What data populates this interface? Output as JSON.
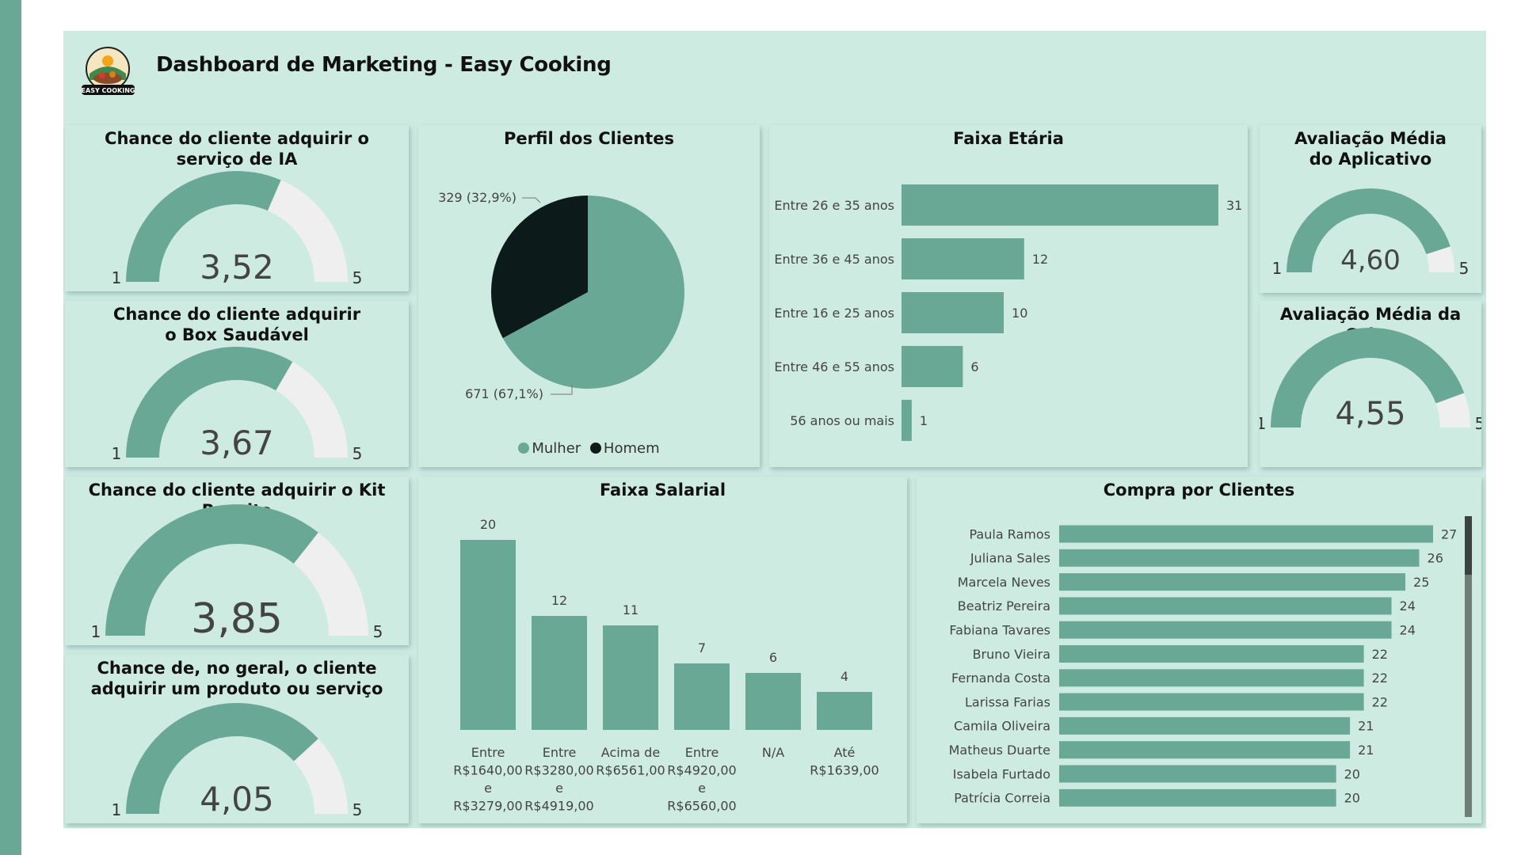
{
  "title": "Dashboard de Marketing - Easy Cooking",
  "logo_text": "EASY COOKING",
  "colors": {
    "primary": "#6aa896",
    "track": "#efefef",
    "dark": "#0d1a1a",
    "background": "#ceebe2"
  },
  "gauges": [
    {
      "title": "Chance do cliente adquirir o serviço de IA",
      "value": 3.52,
      "value_label": "3,52",
      "min_label": "1",
      "max_label": "5",
      "min": 1,
      "max": 5
    },
    {
      "title": "Chance do cliente adquirir o Box Saudável",
      "value": 3.67,
      "value_label": "3,67",
      "min_label": "1",
      "max_label": "5",
      "min": 1,
      "max": 5
    },
    {
      "title": "Chance do cliente adquirir o Kit Receita",
      "value": 3.85,
      "value_label": "3,85",
      "min_label": "1",
      "max_label": "5",
      "min": 1,
      "max": 5
    },
    {
      "title": "Chance de, no geral, o cliente adquirir um produto ou serviço",
      "value": 4.05,
      "value_label": "4,05",
      "min_label": "1",
      "max_label": "5",
      "min": 1,
      "max": 5
    },
    {
      "title": "Avaliação Média do Aplicativo",
      "value": 4.6,
      "value_label": "4,60",
      "min_label": "1",
      "max_label": "5",
      "min": 1,
      "max": 5
    },
    {
      "title": "Avaliação Média da Caixa",
      "value": 4.55,
      "value_label": "4,55",
      "min_label": "1",
      "max_label": "5",
      "min": 1,
      "max": 5
    }
  ],
  "chart_data": [
    {
      "type": "pie",
      "title": "Perfil dos Clientes",
      "categories": [
        "Mulher",
        "Homem"
      ],
      "values": [
        671,
        329
      ],
      "labels": [
        "671 (67,1%)",
        "329 (32,9%)"
      ],
      "colors": [
        "#6aa896",
        "#0d1a1a"
      ]
    },
    {
      "type": "bar",
      "orientation": "horizontal",
      "title": "Faixa Etária",
      "categories": [
        "Entre 26 e 35 anos",
        "Entre 36 e 45 anos",
        "Entre 16 e 25 anos",
        "Entre 46 e 55 anos",
        "56 anos ou mais"
      ],
      "values": [
        31,
        12,
        10,
        6,
        1
      ]
    },
    {
      "type": "bar",
      "title": "Faixa Salarial",
      "categories": [
        [
          "Entre",
          "R$1640,00",
          "e",
          "R$3279,00"
        ],
        [
          "Entre",
          "R$3280,00",
          "e",
          "R$4919,00"
        ],
        [
          "Acima de",
          "R$6561,00"
        ],
        [
          "Entre",
          "R$4920,00",
          "e",
          "R$6560,00"
        ],
        [
          "N/A"
        ],
        [
          "Até",
          "R$1639,00"
        ]
      ],
      "values": [
        20,
        12,
        11,
        7,
        6,
        4
      ]
    },
    {
      "type": "bar",
      "orientation": "horizontal",
      "title": "Compra por Clientes",
      "categories": [
        "Paula Ramos",
        "Juliana Sales",
        "Marcela Neves",
        "Beatriz Pereira",
        "Fabiana Tavares",
        "Bruno Vieira",
        "Fernanda Costa",
        "Larissa Farias",
        "Camila Oliveira",
        "Matheus Duarte",
        "Isabela Furtado",
        "Patrícia Correia"
      ],
      "values": [
        27,
        26,
        25,
        24,
        24,
        22,
        22,
        22,
        21,
        21,
        20,
        20
      ]
    }
  ]
}
